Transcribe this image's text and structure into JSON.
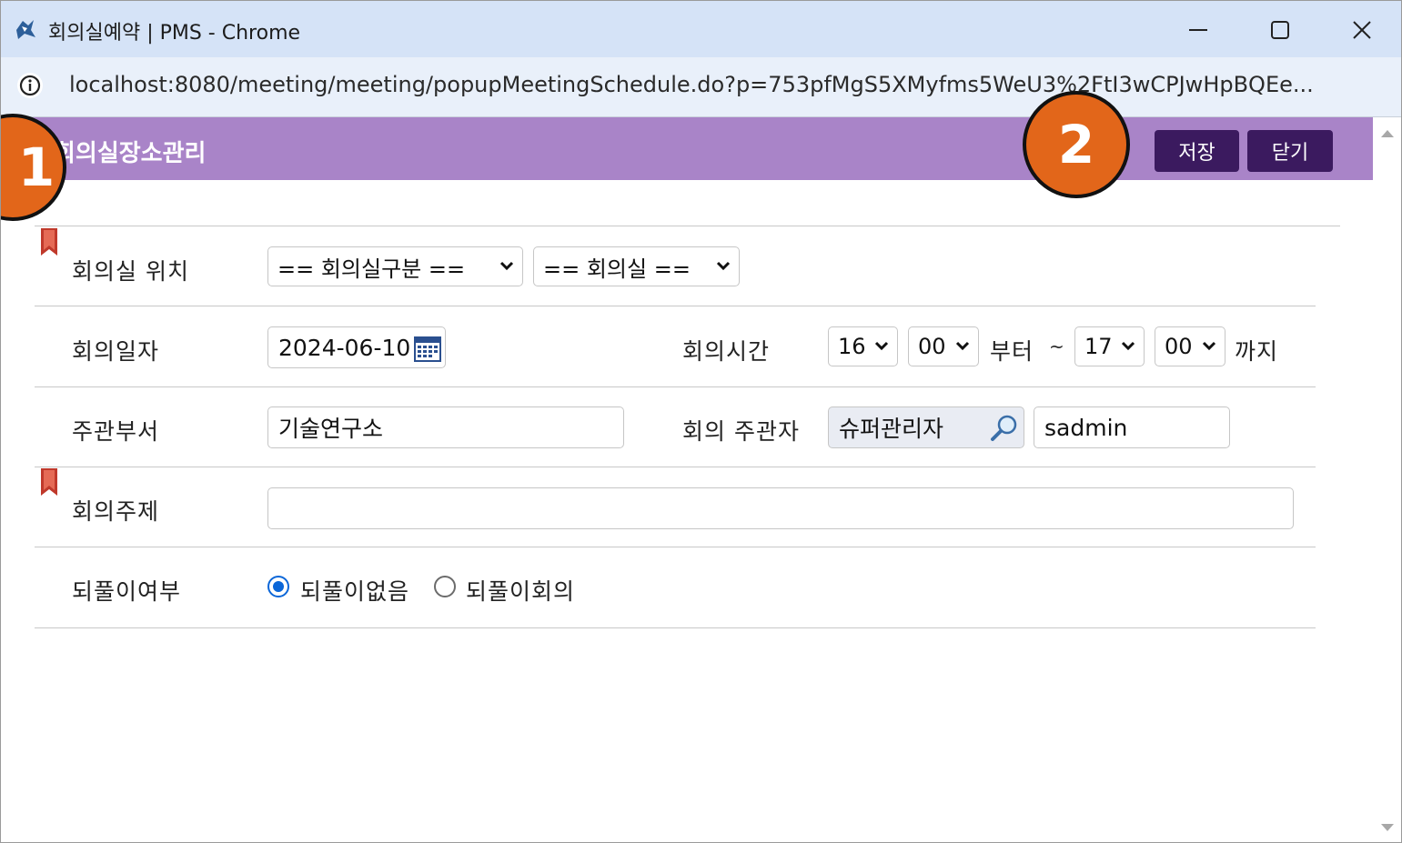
{
  "window": {
    "title": "회의실예약 | PMS - Chrome",
    "url": "localhost:8080/meeting/meeting/popupMeetingSchedule.do?p=753pfMgS5XMyfms5WeU3%2FtI3wCPJwHpBQEe..."
  },
  "header": {
    "title": "회의실장소관리",
    "save_label": "저장",
    "close_label": "닫기"
  },
  "form": {
    "location": {
      "label": "회의실 위치",
      "category_value": "== 회의실구분 ==",
      "room_value": "== 회의실 =="
    },
    "date": {
      "label": "회의일자",
      "value": "2024-06-10"
    },
    "time": {
      "label": "회의시간",
      "start_hour": "16",
      "start_min": "00",
      "from_text": "부터",
      "tilde": "~",
      "end_hour": "17",
      "end_min": "00",
      "until_text": "까지"
    },
    "department": {
      "label": "주관부서",
      "value": "기술연구소"
    },
    "organizer": {
      "label": "회의 주관자",
      "name_value": "슈퍼관리자",
      "id_value": "sadmin"
    },
    "topic": {
      "label": "회의주제",
      "value": ""
    },
    "repeat": {
      "label": "되풀이여부",
      "option_none": "되풀이없음",
      "option_repeat": "되풀이회의",
      "selected": "되풀이없음"
    }
  },
  "annotations": {
    "badge1": "1",
    "badge2": "2"
  },
  "colors": {
    "header_bg": "#a984c8",
    "button_bg": "#3b1a5f",
    "badge": "#e2661a",
    "titlebar": "#d5e3f7",
    "required_marker": "#c0392b"
  }
}
